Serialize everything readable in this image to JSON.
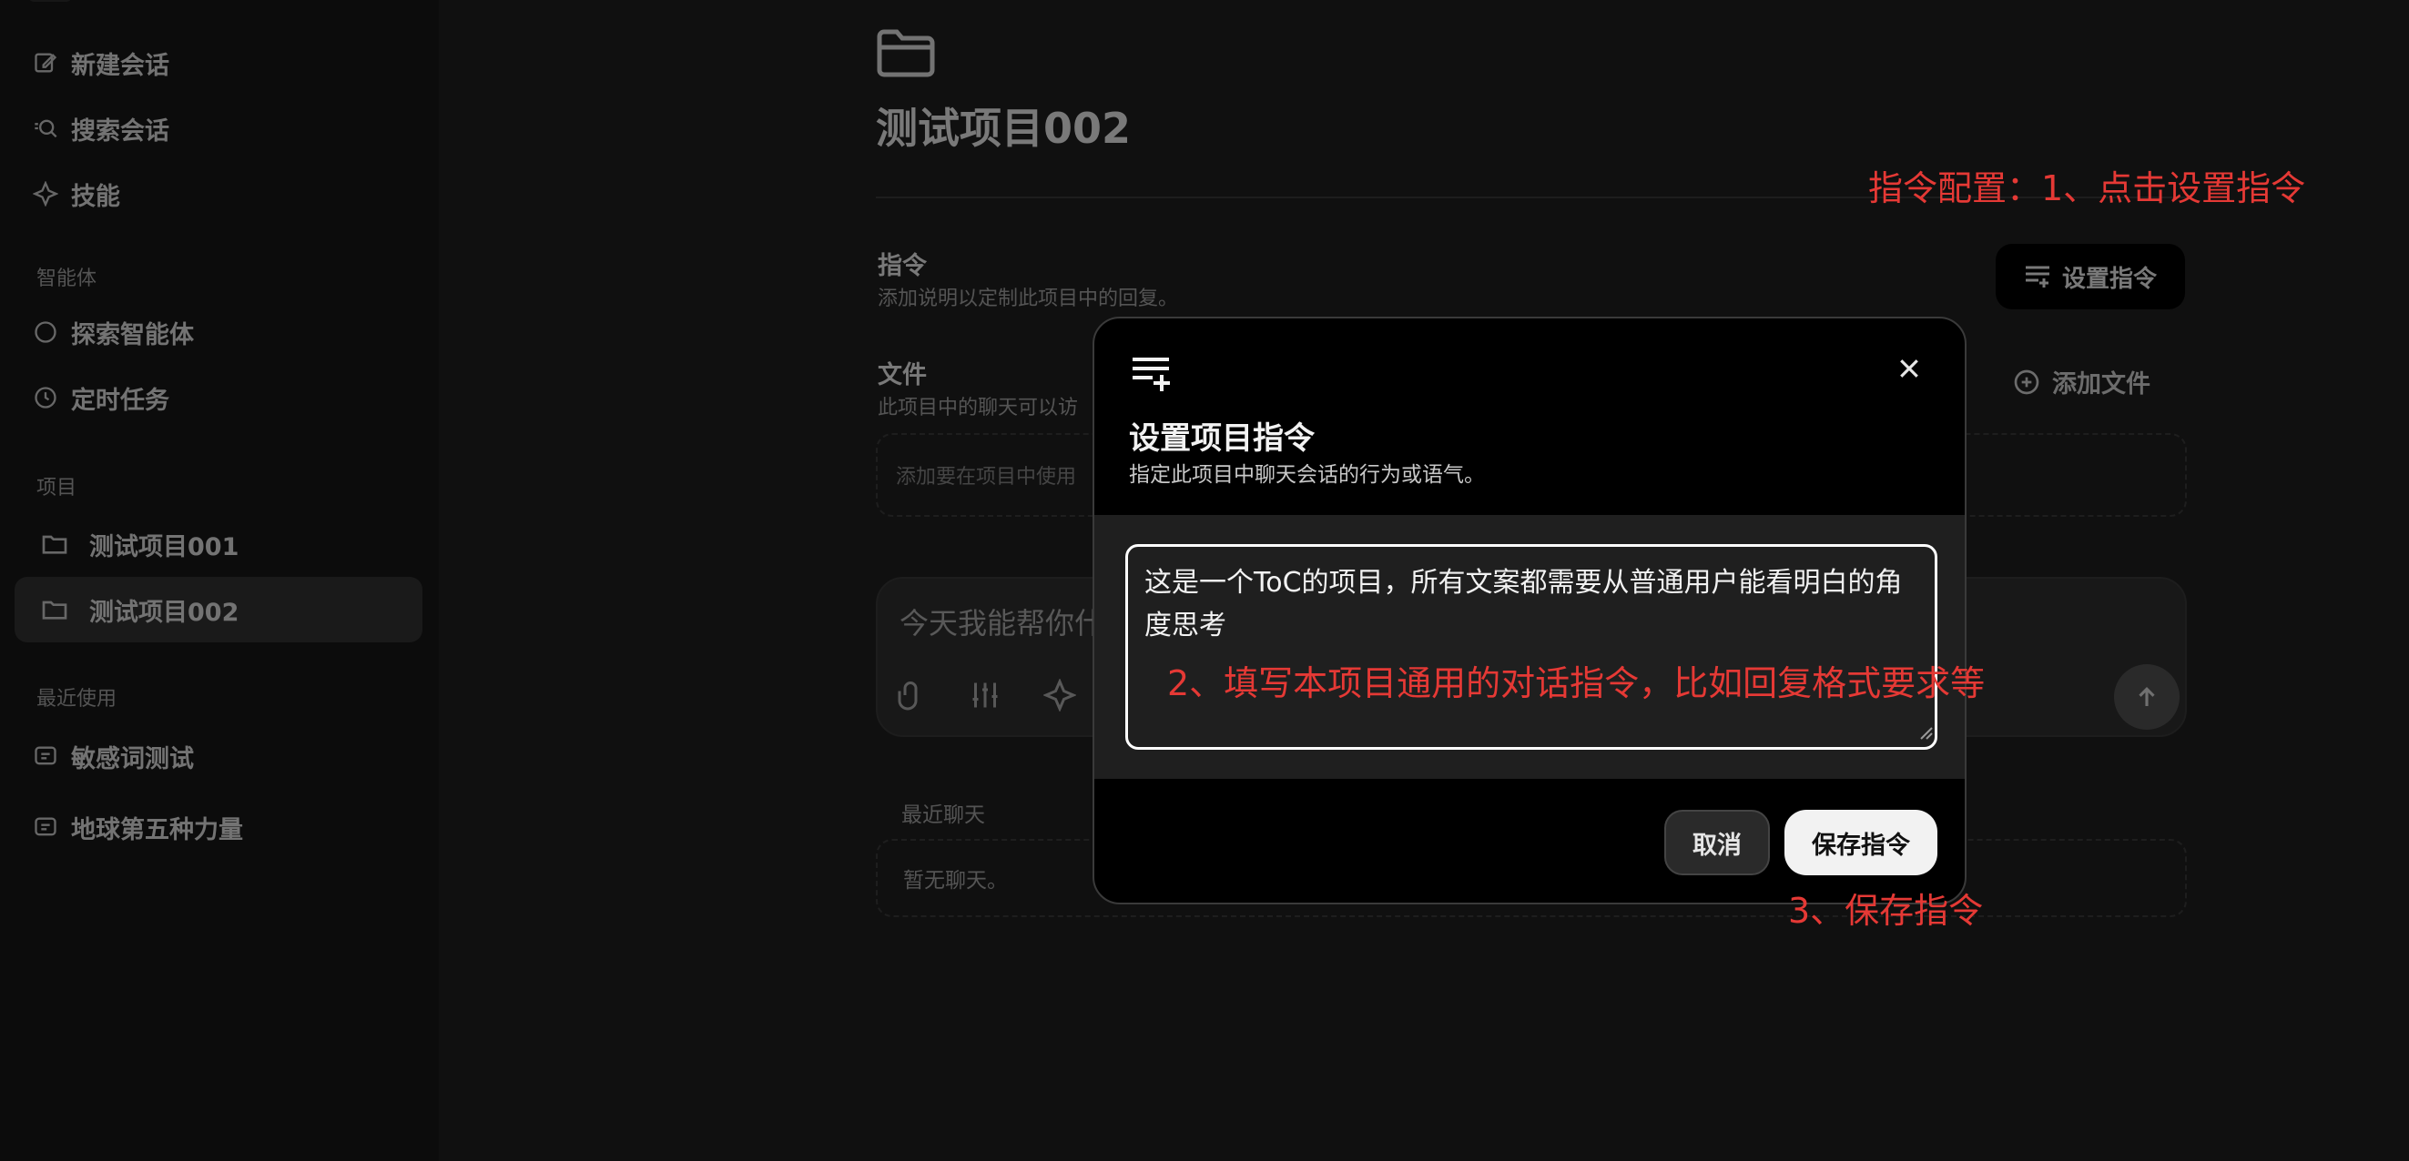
{
  "sidebar": {
    "nav": [
      {
        "label": "新建会话",
        "icon": "edit-icon"
      },
      {
        "label": "搜索会话",
        "icon": "search-icon"
      },
      {
        "label": "技能",
        "icon": "sparkle-icon"
      }
    ],
    "agents_label": "智能体",
    "agents": [
      {
        "label": "探索智能体",
        "icon": "circle-icon"
      },
      {
        "label": "定时任务",
        "icon": "clock-icon"
      }
    ],
    "projects_label": "项目",
    "projects": [
      {
        "label": "测试项目001",
        "active": false
      },
      {
        "label": "测试项目002",
        "active": true
      }
    ],
    "recent_label": "最近使用",
    "recent": [
      {
        "label": "敏感词测试"
      },
      {
        "label": "地球第五种力量"
      }
    ]
  },
  "main": {
    "title": "测试项目002",
    "instructions": {
      "title": "指令",
      "desc": "添加说明以定制此项目中的回复。",
      "button": "设置指令"
    },
    "files": {
      "title": "文件",
      "desc": "此项目中的聊天可以访",
      "add_button": "添加文件",
      "dropzone": "添加要在项目中使用"
    },
    "chat": {
      "placeholder": "今天我能帮你什"
    },
    "recent_chats": {
      "label": "最近聊天",
      "empty": "暂无聊天。"
    }
  },
  "modal": {
    "title": "设置项目指令",
    "subtitle": "指定此项目中聊天会话的行为或语气。",
    "textarea_value": "这是一个ToC的项目，所有文案都需要从普通用户能看明白的角度思考",
    "cancel": "取消",
    "save": "保存指令"
  },
  "annotations": {
    "step1": "指令配置：1、点击设置指令",
    "step2": "2、填写本项目通用的对话指令，比如回复格式要求等",
    "step3": "3、保存指令",
    "color": "#e53935"
  }
}
